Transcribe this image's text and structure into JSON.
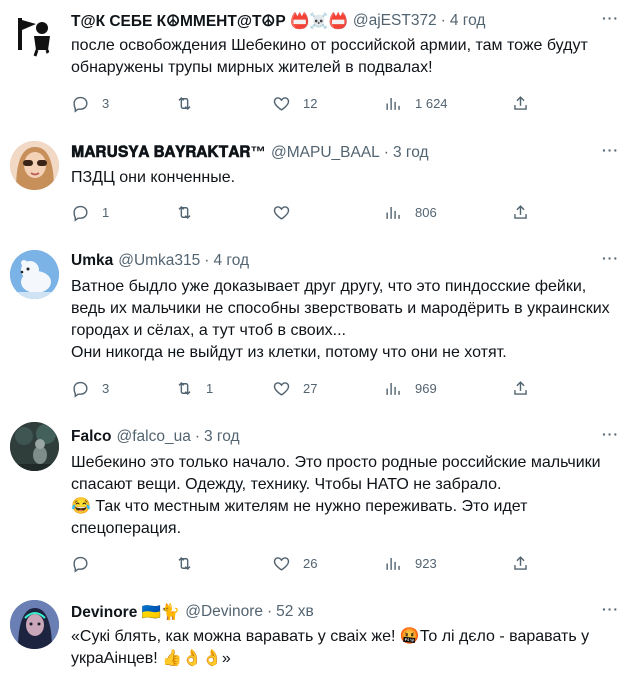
{
  "colors": {
    "text": "#0f1419",
    "muted": "#536471",
    "divider": "#eff3f4"
  },
  "tweets": [
    {
      "name": "Т@К СЕБЕ К☮ММЕНТ@Т☮Р 📛☠️📛",
      "handle": "@ajEST372",
      "time": "4 год",
      "text": "после освобождения Шебекино от российской армии, там тоже будут обнаружены трупы мирных жителей в подвалах!",
      "replies": "3",
      "retweets": "",
      "likes": "12",
      "views": "1 624"
    },
    {
      "name": "𝐌𝐀𝐑𝐔𝐒𝐘𝐀 𝐁𝐀𝐘𝐑𝐀𝐊𝐓𝐀𝐑™",
      "handle": "@MAPU_BAAL",
      "time": "3 год",
      "text": "ПЗДЦ они конченные.",
      "replies": "1",
      "retweets": "",
      "likes": "",
      "views": "806"
    },
    {
      "name": "Umka",
      "handle": "@Umka315",
      "time": "4 год",
      "text": "Ватное быдло уже доказывает друг другу, что это пиндосские фейки, ведь их мальчики не способны зверствовать и мародёрить в украинских городах и сёлах, а тут чтоб в своих...\nОни никогда не выйдут из клетки, потому что они не хотят.",
      "replies": "3",
      "retweets": "1",
      "likes": "27",
      "views": "969"
    },
    {
      "name": "Falco",
      "handle": "@falco_ua",
      "time": "3 год",
      "text": "Шебекино это только начало. Это просто родные российские мальчики спасают вещи. Одежду, технику. Чтобы НАТО не забрало.\n😂 Так что местным жителям не нужно переживать. Это идет спецоперация.",
      "replies": "",
      "retweets": "",
      "likes": "26",
      "views": "923"
    },
    {
      "name": "Devinore 🇺🇦🐈",
      "handle": "@Devinore",
      "time": "52 хв",
      "text": "«Сукі блять, как можна варавать у сваіх же! 🤬То лі дєло - варавать у украАінцев! 👍👌👌»"
    }
  ]
}
